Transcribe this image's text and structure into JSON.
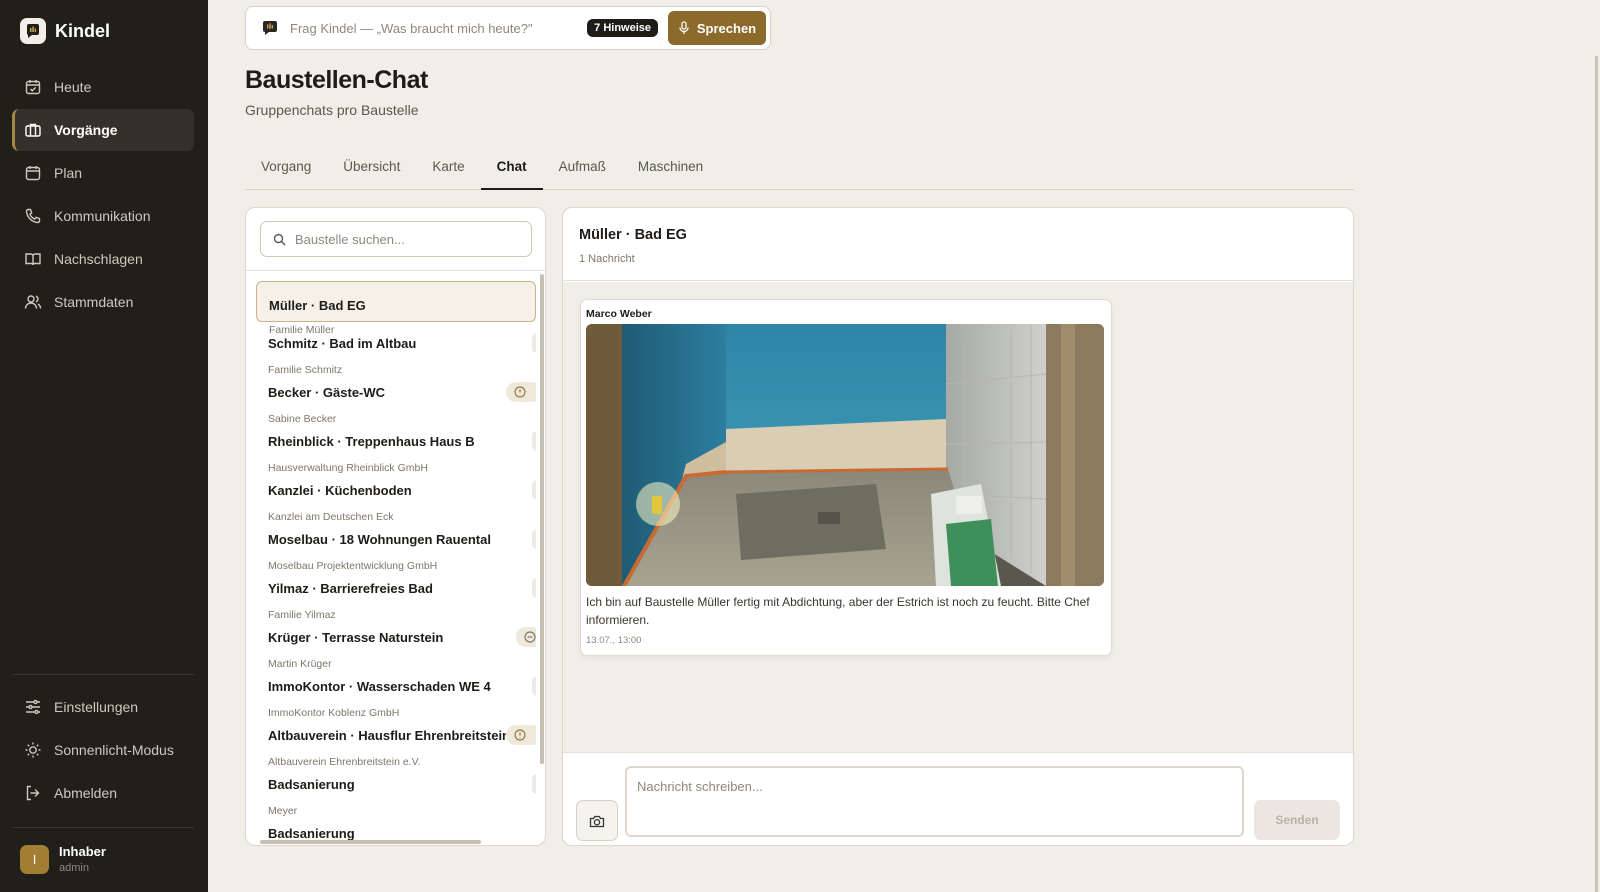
{
  "app": {
    "name": "Kindel"
  },
  "sidebar": {
    "items": [
      {
        "label": "Heute",
        "icon": "calendar-check-icon"
      },
      {
        "label": "Vorgänge",
        "icon": "briefcase-icon",
        "active": true
      },
      {
        "label": "Plan",
        "icon": "calendar-icon"
      },
      {
        "label": "Kommunikation",
        "icon": "phone-icon"
      },
      {
        "label": "Nachschlagen",
        "icon": "book-icon"
      },
      {
        "label": "Stammdaten",
        "icon": "users-icon"
      }
    ],
    "bottom_items": [
      {
        "label": "Einstellungen",
        "icon": "sliders-icon"
      },
      {
        "label": "Sonnenlicht-Modus",
        "icon": "sun-icon"
      },
      {
        "label": "Abmelden",
        "icon": "logout-icon"
      }
    ],
    "user": {
      "initial": "I",
      "name": "Inhaber",
      "role": "admin"
    }
  },
  "ask": {
    "placeholder": "Frag Kindel — „Was braucht mich heute?\"",
    "hints_badge": "7 Hinweise",
    "speak_label": "Sprechen"
  },
  "page": {
    "title": "Baustellen-Chat",
    "subtitle": "Gruppenchats pro Baustelle"
  },
  "tabs": [
    {
      "label": "Vorgang"
    },
    {
      "label": "Übersicht"
    },
    {
      "label": "Karte"
    },
    {
      "label": "Chat",
      "active": true
    },
    {
      "label": "Aufmaß"
    },
    {
      "label": "Maschinen"
    }
  ],
  "site_list": {
    "search_placeholder": "Baustelle suchen...",
    "items": [
      {
        "name": "Müller · Bad EG",
        "client": "Familie Müller",
        "active": true,
        "status": ""
      },
      {
        "name": "Schmitz · Bad im Altbau",
        "client": "Familie Schmitz",
        "status": ""
      },
      {
        "name": "Becker · Gäste-WC",
        "client": "Sabine Becker",
        "status": "alert"
      },
      {
        "name": "Rheinblick · Treppenhaus Haus B",
        "client": "Hausverwaltung Rheinblick GmbH",
        "status": ""
      },
      {
        "name": "Kanzlei · Küchenboden",
        "client": "Kanzlei am Deutschen Eck",
        "status": ""
      },
      {
        "name": "Moselbau · 18 Wohnungen Rauental",
        "client": "Moselbau Projektentwicklung GmbH",
        "status": ""
      },
      {
        "name": "Yilmaz · Barrierefreies Bad",
        "client": "Familie Yilmaz",
        "status": ""
      },
      {
        "name": "Krüger · Terrasse Naturstein",
        "client": "Martin Krüger",
        "status": "paused"
      },
      {
        "name": "ImmoKontor · Wasserschaden WE 4",
        "client": "ImmoKontor Koblenz GmbH",
        "status": ""
      },
      {
        "name": "Altbauverein · Hausflur Ehrenbreitstein",
        "client": "Altbauverein Ehrenbreitstein e.V.",
        "status": "alert"
      },
      {
        "name": "Badsanierung",
        "client": "Meyer",
        "status": ""
      },
      {
        "name": "Badsanierung",
        "client": "",
        "status": ""
      }
    ]
  },
  "chat": {
    "title": "Müller · Bad EG",
    "count": "1 Nachricht",
    "messages": [
      {
        "sender": "Marco Weber",
        "text": "Ich bin auf Baustelle Müller fertig mit Abdichtung, aber der Estrich ist noch zu feucht. Bitte Chef informieren.",
        "time": "13.07., 13:00"
      }
    ],
    "input_placeholder": "Nachricht schreiben...",
    "send_label": "Senden"
  },
  "colors": {
    "sidebar_bg": "#211f1a",
    "page_bg": "#f1eee8",
    "accent": "#8c6a2b"
  }
}
